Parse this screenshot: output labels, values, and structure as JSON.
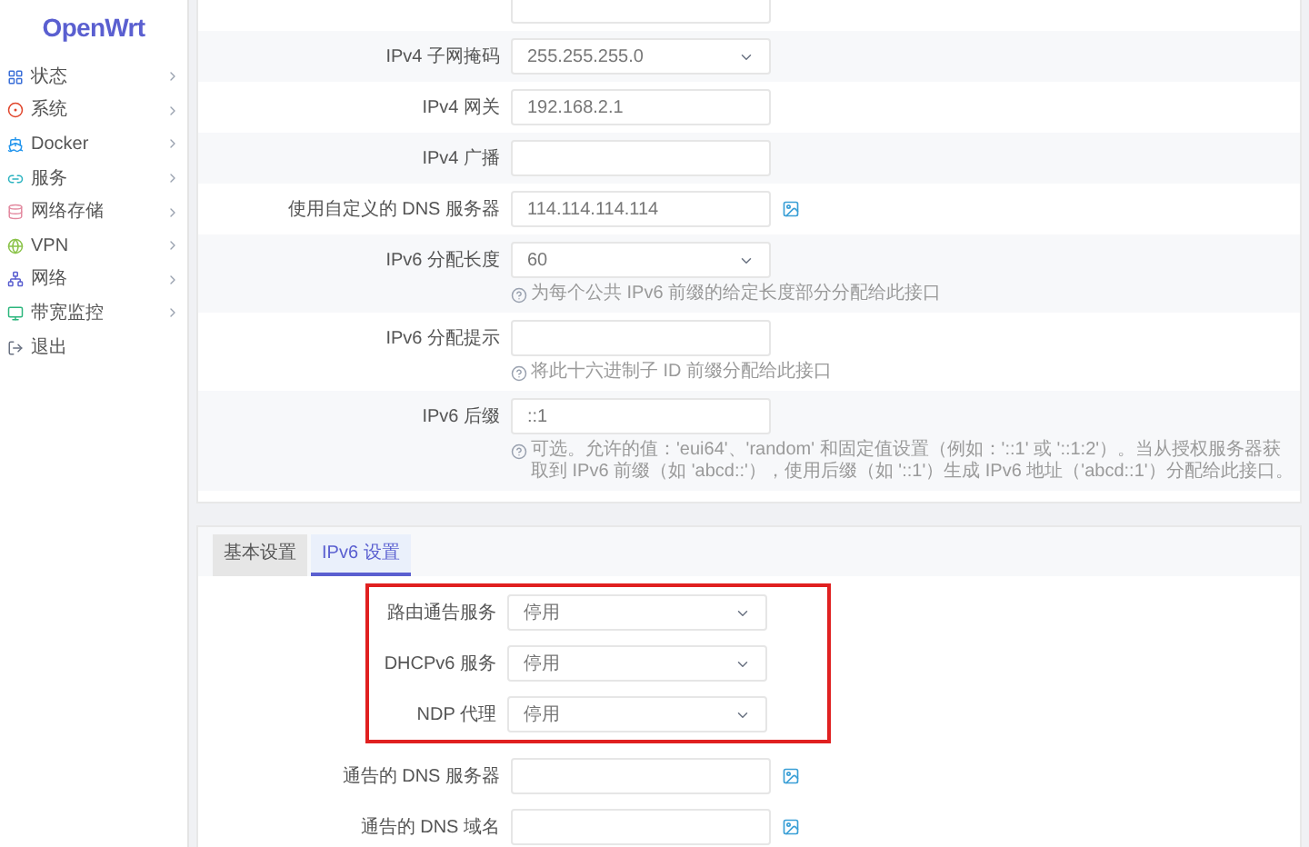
{
  "sidebar": {
    "logo": "OpenWrt",
    "items": [
      {
        "kind": "status",
        "label": "状态",
        "expandable": true
      },
      {
        "kind": "system",
        "label": "系统",
        "expandable": true
      },
      {
        "kind": "docker",
        "label": "Docker",
        "expandable": true
      },
      {
        "kind": "services",
        "label": "服务",
        "expandable": true
      },
      {
        "kind": "storage",
        "label": "网络存储",
        "expandable": true
      },
      {
        "kind": "vpn",
        "label": "VPN",
        "expandable": true
      },
      {
        "kind": "network",
        "label": "网络",
        "expandable": true
      },
      {
        "kind": "monitor",
        "label": "带宽监控",
        "expandable": true
      },
      {
        "kind": "logout",
        "label": "退出",
        "expandable": false
      }
    ]
  },
  "general_rows": [
    {
      "kind": "text"
    },
    {
      "kind": "select",
      "label": "IPv4 子网掩码",
      "value": "255.255.255.0"
    },
    {
      "kind": "text",
      "label": "IPv4 网关",
      "value": "192.168.2.1"
    },
    {
      "kind": "text",
      "label": "IPv4 广播"
    },
    {
      "kind": "text",
      "label": "使用自定义的 DNS 服务器",
      "value": "114.114.114.114",
      "picker": true
    },
    {
      "kind": "select",
      "label": "IPv6 分配长度",
      "value": "60",
      "hint": "为每个公共 IPv6 前缀的给定长度部分分配给此接口"
    },
    {
      "kind": "text",
      "label": "IPv6 分配提示",
      "hint": "将此十六进制子 ID 前缀分配给此接口"
    },
    {
      "kind": "text",
      "label": "IPv6 后缀",
      "value": "::1",
      "hint": "可选。允许的值：'eui64'、'random' 和固定值设置（例如：'::1' 或 '::1:2'）。当从授权服务器获取到 IPv6 前缀（如 'abcd::'），使用后缀（如 '::1'）生成 IPv6 地址（'abcd::1'）分配给此接口。"
    }
  ],
  "tabs": [
    {
      "label": "基本设置",
      "selected": false
    },
    {
      "label": "IPv6 设置",
      "selected": true
    }
  ],
  "groups": [
    {
      "highlighted": true,
      "rows": [
        {
          "kind": "select",
          "label": "路由通告服务",
          "value": "停用"
        },
        {
          "kind": "select",
          "label": "DHCPv6 服务",
          "value": "停用"
        },
        {
          "kind": "select",
          "label": "NDP 代理",
          "value": "停用"
        }
      ]
    },
    {
      "highlighted": false,
      "rows": [
        {
          "kind": "text",
          "label": "通告的 DNS 服务器",
          "picker": true
        },
        {
          "kind": "text",
          "label": "通告的 DNS 域名",
          "picker": true
        }
      ]
    }
  ]
}
